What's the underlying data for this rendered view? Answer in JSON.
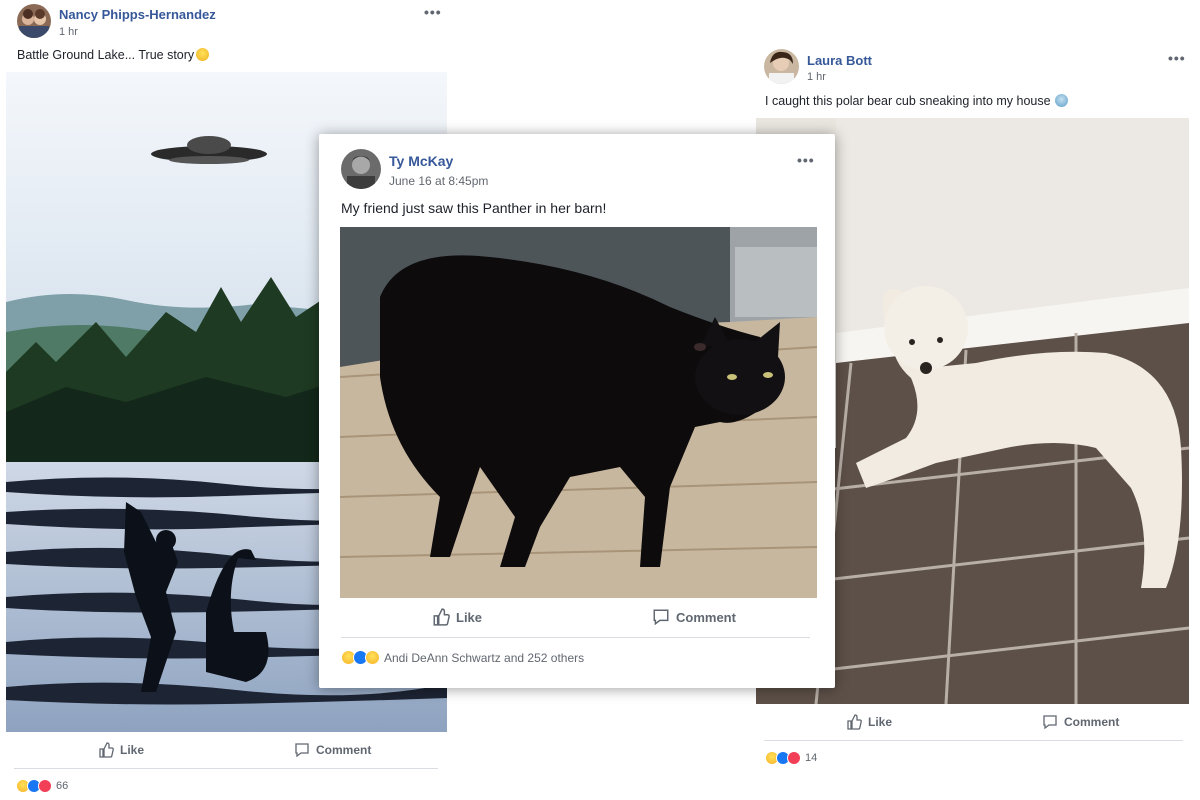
{
  "posts": {
    "left": {
      "author": "Nancy Phipps-Hernandez",
      "time": "1 hr",
      "text": "Battle Ground Lake... True story",
      "text_emoji": "smile-emoji",
      "image": "ufo, bigfoot and loch ness monster collage",
      "like_label": "Like",
      "comment_label": "Comment",
      "reaction_count": "66",
      "reactions": [
        "haha",
        "like",
        "love"
      ]
    },
    "center": {
      "author": "Ty McKay",
      "time": "June 16 at 8:45pm",
      "text": "My friend just saw this Panther in her barn!",
      "image": "black cat in barn",
      "like_label": "Like",
      "comment_label": "Comment",
      "reaction_summary": "Andi DeAnn Schwartz and 252 others",
      "reactions": [
        "haha",
        "like",
        "wow"
      ]
    },
    "right": {
      "author": "Laura Bott",
      "time": "1 hr",
      "text": "I caught this polar bear cub sneaking into my house",
      "text_emoji": "scream-emoji",
      "image": "white poodle on tile floor",
      "like_label": "Like",
      "comment_label": "Comment",
      "reaction_count": "14",
      "reactions": [
        "haha",
        "like",
        "love"
      ]
    }
  },
  "icons": {
    "more": "more-options-icon",
    "like": "thumbs-up-icon",
    "comment": "comment-bubble-icon"
  },
  "colors": {
    "author": "#365899",
    "meta": "#616770",
    "action": "#606770",
    "like_reaction": "#1877f2",
    "love_reaction": "#f33e58",
    "haha_reaction": "#f7b125"
  }
}
